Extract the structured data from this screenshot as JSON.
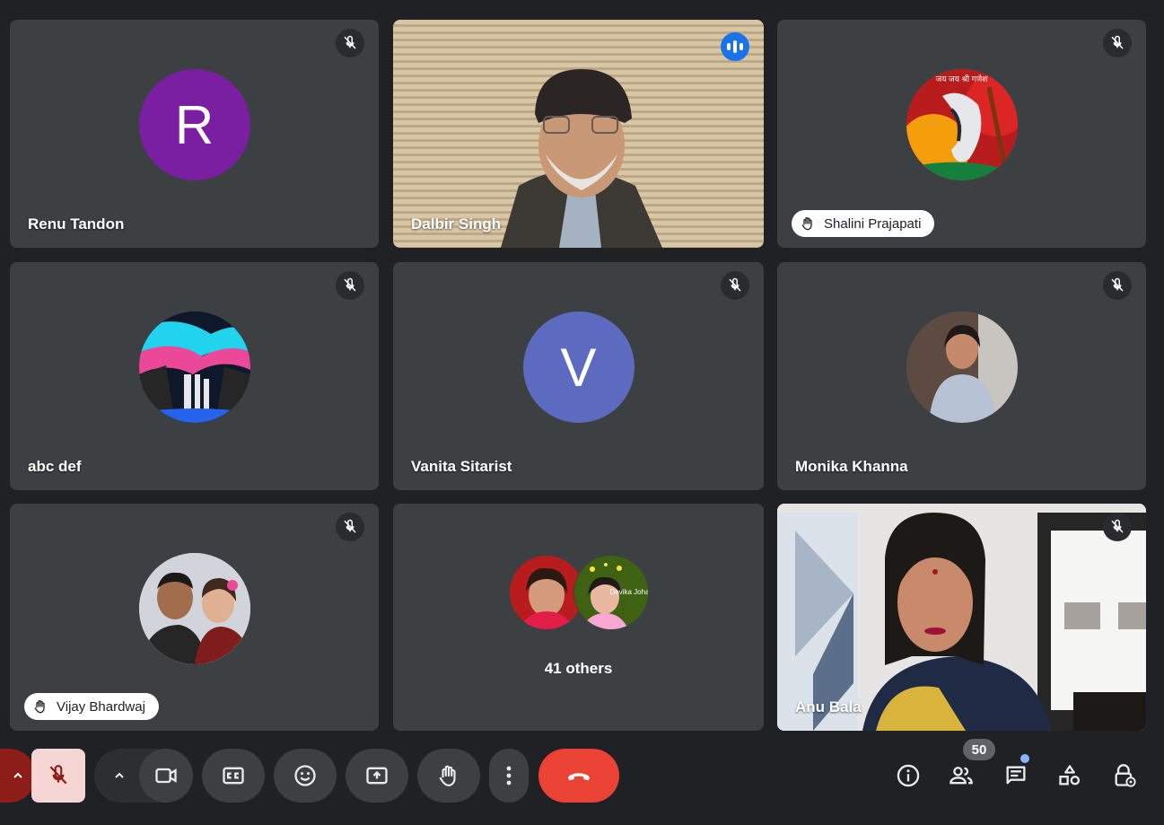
{
  "participants": [
    {
      "name": "Renu Tandon",
      "initial": "R",
      "avatar_color": "#7b1fa2",
      "muted": true
    },
    {
      "name": "Dalbir Singh",
      "video": true,
      "speaking": true
    },
    {
      "name": "Shalini Prajapati",
      "muted": true,
      "hand_raised": true,
      "avatar_text": "जय जय श्री गणेश"
    },
    {
      "name": "abc def",
      "muted": true
    },
    {
      "name": "Vanita Sitarist",
      "initial": "V",
      "avatar_color": "#5c6bc0",
      "muted": true
    },
    {
      "name": "Monika Khanna",
      "muted": true
    },
    {
      "name": "Vijay Bhardwaj",
      "muted": true,
      "hand_raised": true
    },
    {
      "name": "Anu Bala",
      "video": true,
      "muted": true
    }
  ],
  "others": {
    "label": "41 others",
    "preview_caption": "Devika Johari"
  },
  "toolbar": {
    "participant_count": "50",
    "icons": [
      "chevron-up-icon",
      "mic-off-icon",
      "chevron-up-icon",
      "camera-icon",
      "captions-icon",
      "emoji-icon",
      "present-icon",
      "raise-hand-icon",
      "more-options-icon",
      "end-call-icon",
      "info-icon",
      "people-icon",
      "chat-icon",
      "activities-icon",
      "host-controls-icon"
    ]
  },
  "colors": {
    "background": "#202124",
    "tile": "#3c4043",
    "speaking_outline": "#8ab4f8",
    "end_call": "#ea4335",
    "mic_off_bg": "#f6d6d4"
  }
}
